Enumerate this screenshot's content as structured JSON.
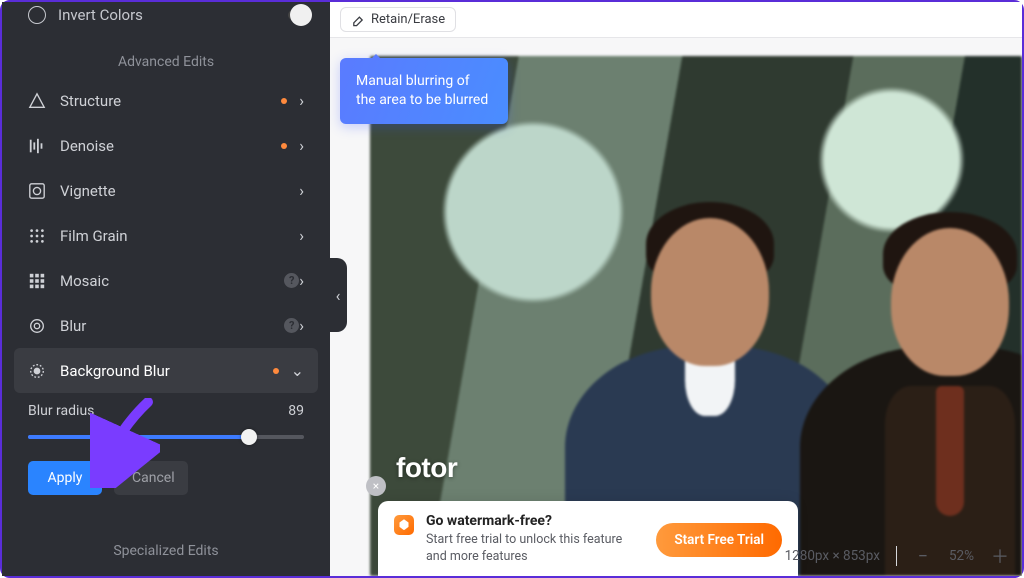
{
  "sidebar": {
    "top_item": "Invert Colors",
    "section_advanced": "Advanced Edits",
    "section_specialized": "Specialized Edits",
    "items": [
      {
        "label": "Structure",
        "dot": true,
        "arrow": ">",
        "help": false
      },
      {
        "label": "Denoise",
        "dot": true,
        "arrow": ">",
        "help": false
      },
      {
        "label": "Vignette",
        "dot": false,
        "arrow": ">",
        "help": false
      },
      {
        "label": "Film Grain",
        "dot": false,
        "arrow": ">",
        "help": false
      },
      {
        "label": "Mosaic",
        "dot": false,
        "arrow": ">",
        "help": true
      },
      {
        "label": "Blur",
        "dot": false,
        "arrow": ">",
        "help": true
      },
      {
        "label": "Background Blur",
        "dot": true,
        "arrow": "v",
        "help": false
      }
    ],
    "slider_label": "Blur radius",
    "slider_value": "89",
    "apply": "Apply",
    "cancel": "Cancel"
  },
  "toolbar": {
    "retain_erase": "Retain/Erase"
  },
  "tooltip": {
    "text": "Manual blurring of the area to be blurred"
  },
  "watermark": "fotor",
  "promo": {
    "title": "Go watermark-free?",
    "subtitle": "Start free trial to unlock this feature and more features",
    "cta": "Start Free Trial"
  },
  "status": {
    "dims": "1280px × 853px",
    "zoom": "52%"
  }
}
